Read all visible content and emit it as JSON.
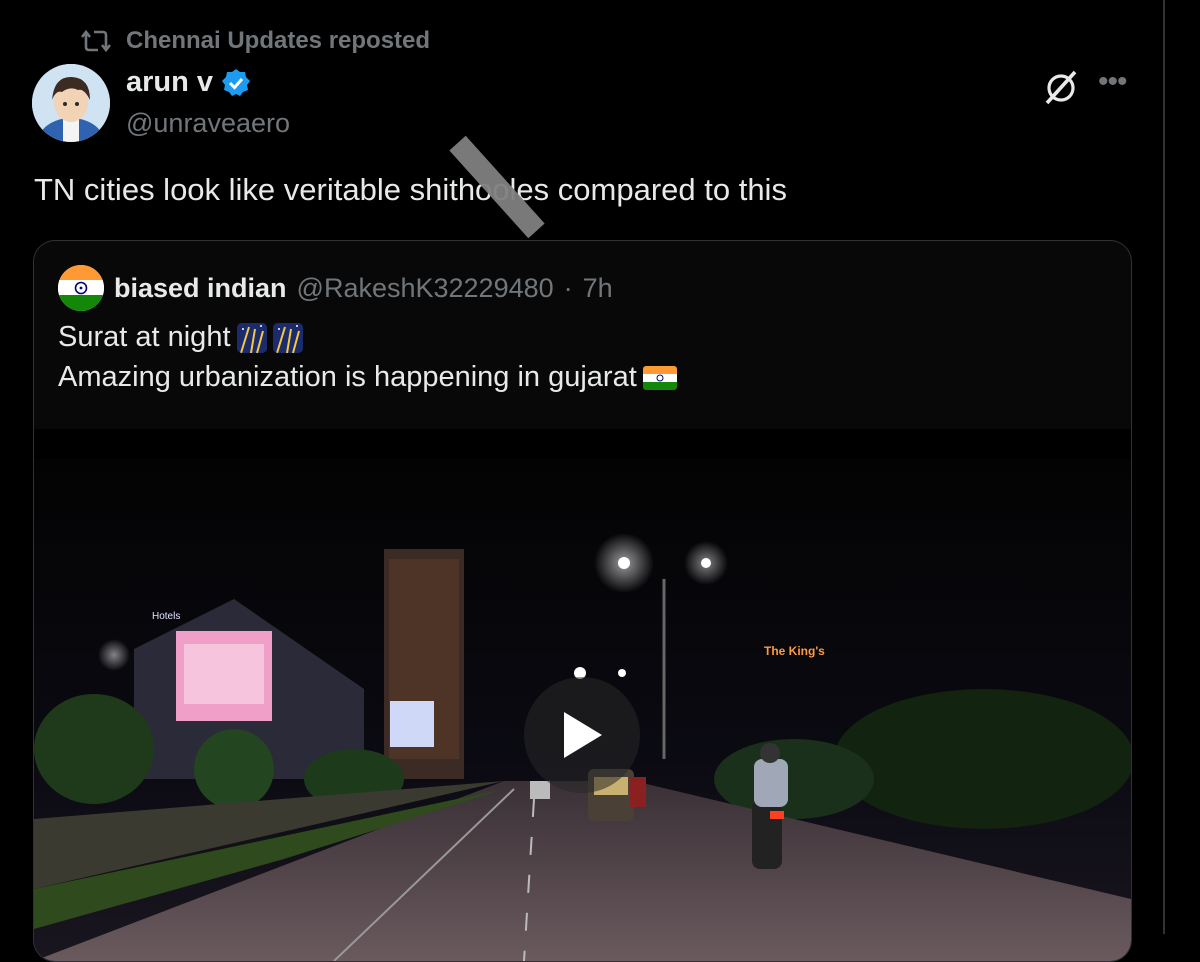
{
  "repost": {
    "icon": "repost-icon",
    "text": "Chennai Updates reposted"
  },
  "post": {
    "author_name": "arun v",
    "verified": true,
    "handle": "@unraveaero",
    "text": "TN cities look like veritable shithooles compared to this",
    "actions": {
      "grok_icon": "grok-icon",
      "more_icon": "more-icon"
    }
  },
  "quoted": {
    "author_name": "biased indian",
    "handle": "@RakeshK32229480",
    "separator": "·",
    "time": "7h",
    "line1": "Surat at night",
    "line2": "Amazing urbanization is happening in gujarat",
    "media": {
      "type": "video",
      "play_icon": "play-icon"
    }
  },
  "colors": {
    "background": "#000000",
    "text": "#e7e9ea",
    "muted": "#71767b",
    "border": "#2f3336",
    "verified": "#1d9bf0"
  }
}
